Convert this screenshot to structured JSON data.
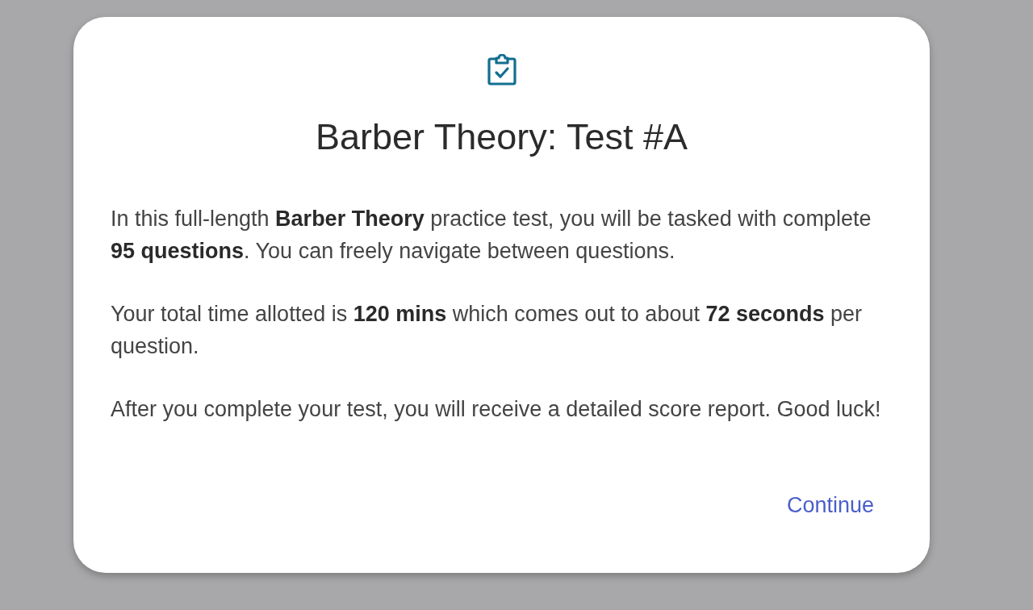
{
  "dialog": {
    "title": "Barber Theory: Test #A",
    "paragraphs": [
      "In this full-length **Barber Theory** practice test, you will be tasked with complete **95 questions**. You can freely navigate between questions.",
      "Your total time allotted is **120 mins** which comes out to about **72 seconds** per question.",
      "After you complete your test, you will receive a detailed score report. Good luck!"
    ],
    "action": {
      "label": "Continue"
    }
  }
}
